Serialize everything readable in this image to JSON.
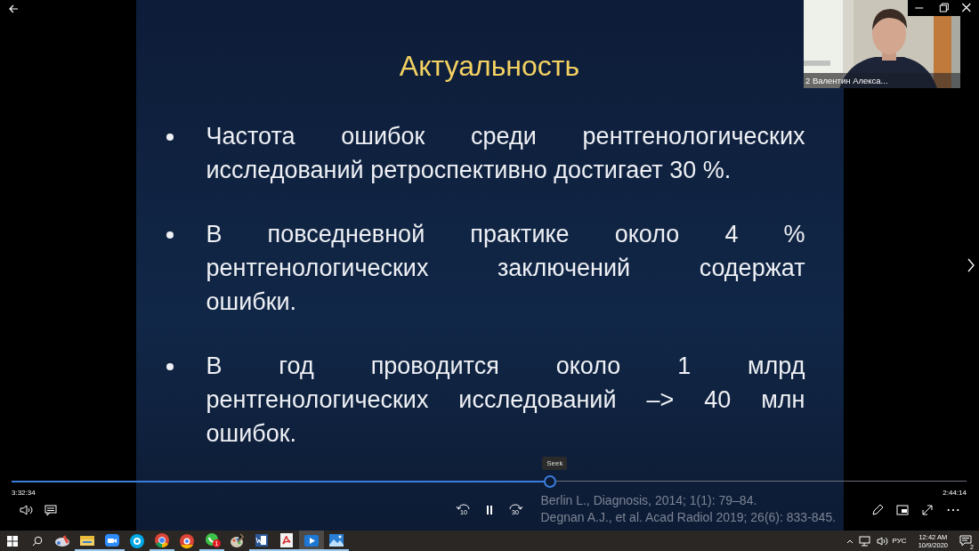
{
  "slide": {
    "title": "Актуальность",
    "bullets": [
      {
        "lines": [
          "Частота ошибок среди рентгенологических",
          "исследований ретроспективно достигает 30 %."
        ]
      },
      {
        "lines": [
          "В повседневной практике около 4 %",
          "рентгенологических заключений содержат",
          "ошибки."
        ]
      },
      {
        "lines": [
          "В год проводится около 1 млрд",
          "рентгенологических исследований –> 40 млн",
          "ошибок."
        ]
      }
    ],
    "citations": [
      "Berlin L., Diagnosis, 2014; 1(1): 79–84.",
      "Degnan A.J., et al. Acad Radiol 2019; 26(6): 833-845."
    ]
  },
  "webcam": {
    "kind": "picture",
    "label": "2 Валентин Алекса..."
  },
  "player": {
    "tooltip": "Seek",
    "level": 0.564,
    "elapsed": "3:32:34",
    "remaining": "2:44:14",
    "rewind": "10",
    "forward": "30",
    "more": "⋯"
  },
  "taskbar": {
    "apps": [
      {
        "kind": "paint",
        "running": false,
        "selected": false
      },
      {
        "kind": "folder",
        "running": true,
        "selected": false
      },
      {
        "kind": "camera",
        "running": true,
        "selected": false
      },
      {
        "kind": "chat",
        "running": false,
        "selected": false
      },
      {
        "kind": "browser",
        "running": true,
        "selected": false
      },
      {
        "kind": "browser2",
        "running": false,
        "selected": false
      },
      {
        "kind": "phone",
        "running": true,
        "selected": false,
        "badge": "1"
      },
      {
        "kind": "palette",
        "running": false,
        "selected": false
      },
      {
        "kind": "doc",
        "running": true,
        "selected": false
      },
      {
        "kind": "pdf",
        "running": true,
        "selected": false
      },
      {
        "kind": "video",
        "running": true,
        "selected": true
      },
      {
        "kind": "photos",
        "running": true,
        "selected": false
      }
    ],
    "language": "РУС",
    "time": "12:42 AM",
    "date": "10/9/2020",
    "notifications": "2"
  }
}
